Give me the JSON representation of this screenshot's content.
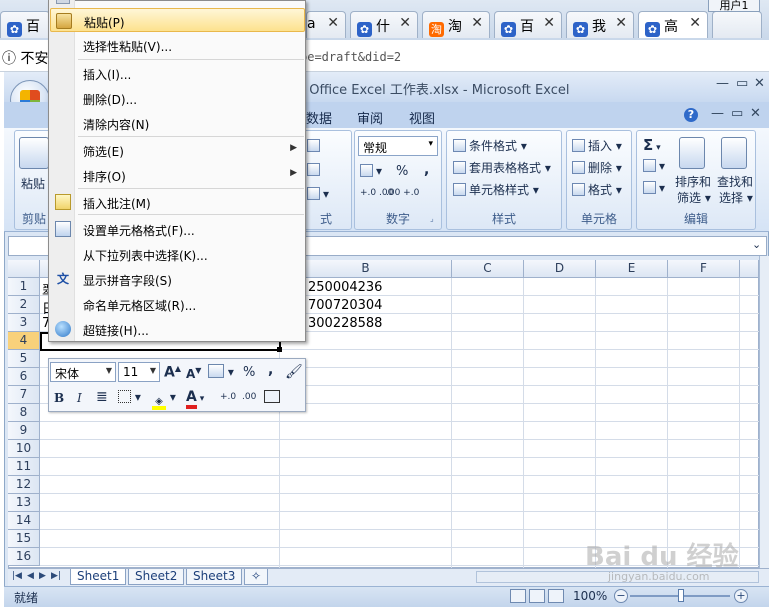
{
  "browser": {
    "tabs": [
      {
        "title": "百",
        "icon": "paw-icon"
      },
      {
        "title": "什",
        "icon": "paw-icon"
      },
      {
        "title": "淘",
        "icon": "taobao-icon"
      },
      {
        "title": "百",
        "icon": "paw-icon"
      },
      {
        "title": "我",
        "icon": "paw-icon"
      },
      {
        "title": "高",
        "icon": "paw-icon"
      }
    ],
    "partial_tab_text": "a",
    "user_button": "用户1",
    "insecure_label": "不安全",
    "url_tail": "pe=draft&did=2"
  },
  "excel": {
    "title": "t Office Excel 工作表.xlsx - Microsoft Excel",
    "ribbon_tabs": [
      "数据",
      "审阅",
      "视图"
    ],
    "groups": {
      "clipboard": {
        "paste_label": "粘贴",
        "label": "剪贴"
      },
      "number": {
        "format": "常规",
        "label": "数字",
        "percent": "%",
        "comma": ",",
        "inc_decimal": "+.0 .00",
        "dec_decimal": ".00 +.0"
      },
      "styles": {
        "conditional": "条件格式",
        "table": "套用表格格式",
        "cell_styles": "单元格样式",
        "label": "样式"
      },
      "cells": {
        "insert": "插入",
        "delete": "删除",
        "format": "格式",
        "label": "单元格"
      },
      "editing": {
        "sum": "Σ",
        "sort_filter_1": "排序和",
        "sort_filter_2": "筛选",
        "find_1": "查找和",
        "find_2": "选择",
        "label": "编辑"
      },
      "alignment": {
        "label": "式"
      }
    },
    "columns": [
      "B",
      "C",
      "D",
      "E",
      "F"
    ],
    "rows": [
      "1",
      "2",
      "3",
      "4",
      "5",
      "6",
      "7",
      "8",
      "9",
      "10",
      "11",
      "12",
      "13",
      "14",
      "15",
      "16"
    ],
    "selected_row": "4",
    "cells": {
      "A1": "翠",
      "B1": "250004236",
      "A2": "日",
      "B2": "700720304",
      "A3": "7",
      "B3": "300228588"
    },
    "sheets": [
      "Sheet1",
      "Sheet2",
      "Sheet3"
    ],
    "status": "就绪",
    "zoom": "100%",
    "zoom_minus": "−",
    "zoom_plus": "+"
  },
  "context_menu": {
    "items": [
      {
        "label": "粘贴(P)",
        "icon": "paste-icon",
        "highlighted": true
      },
      {
        "label": "选择性粘贴(V)...",
        "icon": ""
      },
      {
        "label": "插入(I)...",
        "icon": ""
      },
      {
        "label": "删除(D)...",
        "icon": ""
      },
      {
        "label": "清除内容(N)",
        "icon": ""
      },
      {
        "label": "筛选(E)",
        "icon": "",
        "submenu": true
      },
      {
        "label": "排序(O)",
        "icon": "",
        "submenu": true
      },
      {
        "label": "插入批注(M)",
        "icon": "comment-icon"
      },
      {
        "label": "设置单元格格式(F)...",
        "icon": "format-cells-icon"
      },
      {
        "label": "从下拉列表中选择(K)...",
        "icon": ""
      },
      {
        "label": "显示拼音字段(S)",
        "icon": "phonetic-icon"
      },
      {
        "label": "命名单元格区域(R)...",
        "icon": ""
      },
      {
        "label": "超链接(H)...",
        "icon": "hyperlink-icon"
      }
    ]
  },
  "mini_toolbar": {
    "font": "宋体",
    "size": "11",
    "grow_font": "A",
    "shrink_font": "A",
    "percent": "%",
    "comma": ",",
    "bold": "B",
    "italic": "I",
    "font_color_letter": "A",
    "inc_decimal": "+.0",
    "dec_decimal": ".00"
  },
  "watermark": {
    "text": "Bai du 经验",
    "sub": "jingyan.baidu.com"
  }
}
